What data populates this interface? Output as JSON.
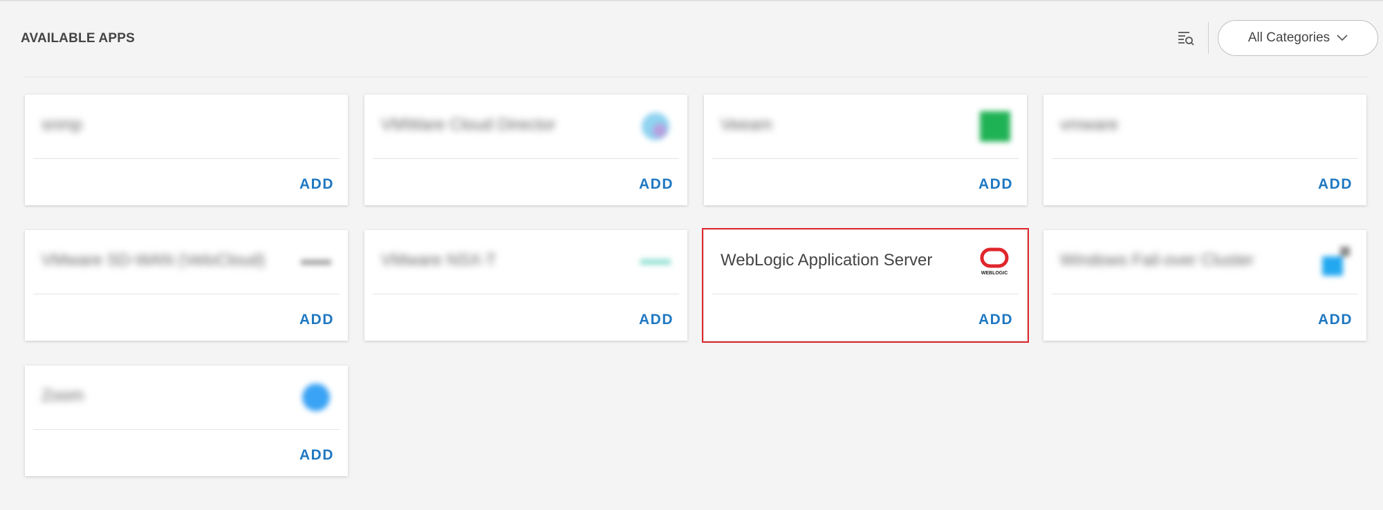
{
  "header": {
    "title": "AVAILABLE APPS",
    "filter_icon": "filter-search-icon",
    "category_select": {
      "selected": "All Categories"
    }
  },
  "apps": [
    {
      "name": "snmp",
      "action": "ADD",
      "logo": "none"
    },
    {
      "name": "VMWare Cloud Director",
      "action": "ADD",
      "logo": "vmware-cloud-director-icon"
    },
    {
      "name": "Veeam",
      "action": "ADD",
      "logo": "veeam-icon"
    },
    {
      "name": "vmware",
      "action": "ADD",
      "logo": "none"
    },
    {
      "name": "VMware SD-WAN (VeloCloud)",
      "action": "ADD",
      "logo": "velocloud-icon"
    },
    {
      "name": "VMware NSX-T",
      "action": "ADD",
      "logo": "nsx-icon"
    },
    {
      "name": "WebLogic Application Server",
      "action": "ADD",
      "logo": "weblogic-icon",
      "logo_text": "WEBLOGIC",
      "selected": true
    },
    {
      "name": "Windows Fail-over Cluster",
      "action": "ADD",
      "logo": "windows-icon"
    },
    {
      "name": "Zoom",
      "action": "ADD",
      "logo": "zoom-icon"
    }
  ],
  "colors": {
    "accent": "#1f78c1",
    "selection": "#e0262c",
    "background": "#f4f4f4"
  }
}
